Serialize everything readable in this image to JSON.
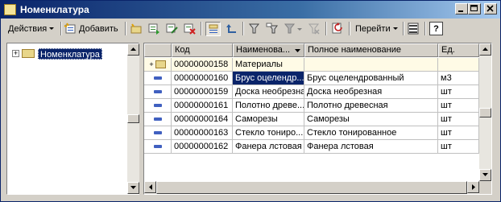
{
  "window": {
    "title": "Номенклатура"
  },
  "titlebar_buttons": [
    {
      "name": "minimize-button",
      "glyph": "minimize-icon"
    },
    {
      "name": "maximize-button",
      "glyph": "maximize-icon"
    },
    {
      "name": "close-button",
      "glyph": "close-icon"
    }
  ],
  "toolbar": {
    "actions_label": "Действия",
    "add_label": "Добавить",
    "goto_label": "Перейти",
    "help_label": "?"
  },
  "tree": {
    "root_label": "Номенклатура",
    "expander": "+"
  },
  "grid": {
    "columns": [
      "",
      "Код",
      "Наименова...",
      "Полное наименование",
      "Ед."
    ],
    "rows": [
      {
        "kind": "group",
        "code": "00000000158",
        "name": "Материалы",
        "full_name": "",
        "unit": ""
      },
      {
        "kind": "item",
        "code": "00000000160",
        "name": "Брус оцелендр...",
        "full_name": "Брус оцелендрованный",
        "unit": "м3",
        "active": true
      },
      {
        "kind": "item",
        "code": "00000000159",
        "name": "Доска необрезная",
        "full_name": "Доска необрезная",
        "unit": "шт"
      },
      {
        "kind": "item",
        "code": "00000000161",
        "name": "Полотно древе...",
        "full_name": "Полотно древесная",
        "unit": "шт"
      },
      {
        "kind": "item",
        "code": "00000000164",
        "name": "Саморезы",
        "full_name": "Саморезы",
        "unit": "шт"
      },
      {
        "kind": "item",
        "code": "00000000163",
        "name": "Стекло тониро...",
        "full_name": "Стекло тонированное",
        "unit": "шт"
      },
      {
        "kind": "item",
        "code": "00000000162",
        "name": "Фанера лстовая",
        "full_name": "Фанера лстовая",
        "unit": "шт"
      }
    ]
  },
  "colors": {
    "title_start": "#0a246a",
    "title_end": "#a6caf0",
    "selection": "#0a246a",
    "face": "#d4d0c8"
  }
}
